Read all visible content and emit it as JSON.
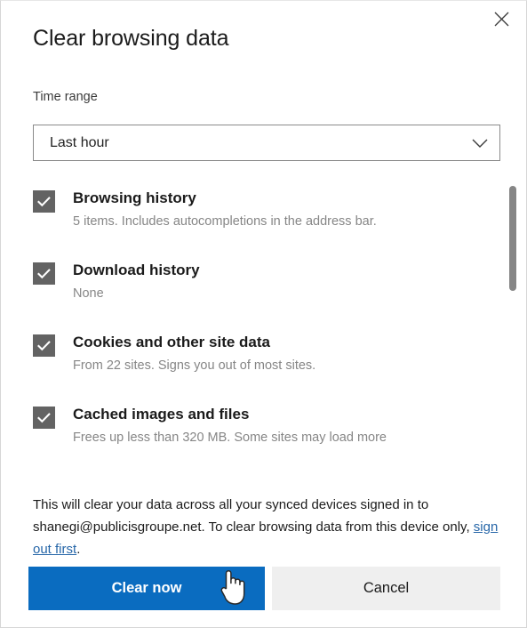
{
  "dialog": {
    "title": "Clear browsing data",
    "close_icon": "close-icon"
  },
  "time_range": {
    "label": "Time range",
    "selected": "Last hour",
    "chevron_icon": "chevron-down-icon"
  },
  "items": [
    {
      "title": "Browsing history",
      "description": "5 items. Includes autocompletions in the address bar.",
      "checked": "checked",
      "check_icon": "check-icon"
    },
    {
      "title": "Download history",
      "description": "None",
      "checked": "checked",
      "check_icon": "check-icon"
    },
    {
      "title": "Cookies and other site data",
      "description": "From 22 sites. Signs you out of most sites.",
      "checked": "checked",
      "check_icon": "check-icon"
    },
    {
      "title": "Cached images and files",
      "description": "Frees up less than 320 MB. Some sites may load more",
      "checked": "checked",
      "check_icon": "check-icon"
    }
  ],
  "sync_note": {
    "text_before": "This will clear your data across all your synced devices signed in to shanegi@publicisgroupe.net. To clear browsing data from this device only, ",
    "link_text": "sign out first",
    "text_after": ".",
    "account_email": "shanegi@publicisgroupe.net"
  },
  "footer": {
    "primary_label": "Clear now",
    "secondary_label": "Cancel"
  },
  "colors": {
    "accent_blue": "#0a6cc0",
    "link_blue": "#2666a8",
    "checkbox_gray": "#636363",
    "secondary_button": "#efefef",
    "description_text": "#868686",
    "scrollbar_thumb": "#868686"
  }
}
